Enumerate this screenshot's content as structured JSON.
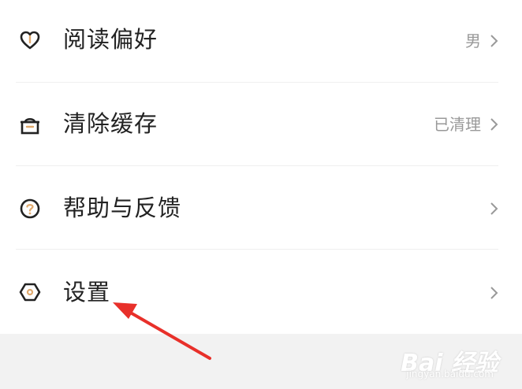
{
  "menu": {
    "items": [
      {
        "label": "阅读偏好",
        "value": "男",
        "icon": "heart-icon"
      },
      {
        "label": "清除缓存",
        "value": "已清理",
        "icon": "basket-icon"
      },
      {
        "label": "帮助与反馈",
        "value": "",
        "icon": "help-icon"
      },
      {
        "label": "设置",
        "value": "",
        "icon": "settings-icon"
      }
    ]
  },
  "watermark": {
    "brand": "Bai 经验",
    "url": "jingyan.baidu.com"
  },
  "colors": {
    "label": "#222222",
    "value": "#999999",
    "icon_outline": "#222222",
    "icon_accent": "#e0a96d",
    "arrow": "#e8302a",
    "footer_bg": "#f2f2f2"
  }
}
